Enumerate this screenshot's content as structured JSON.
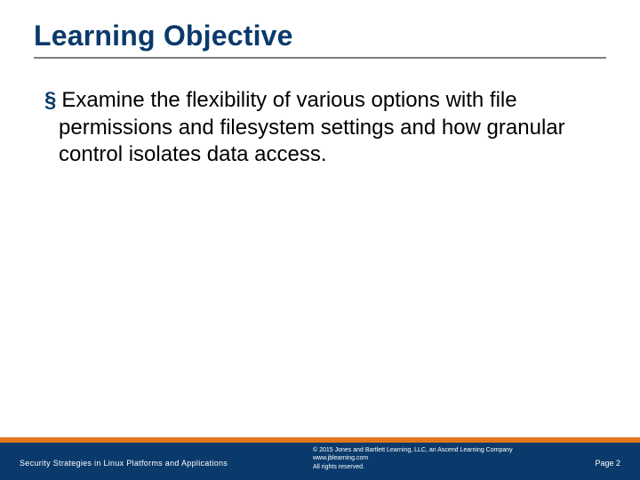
{
  "title": "Learning Objective",
  "bullet": {
    "marker": "§",
    "text": "Examine the flexibility of various options with file permissions and filesystem settings and how granular control isolates data access."
  },
  "footer": {
    "left": "Security Strategies in Linux Platforms and Applications",
    "copyright_line1": "© 2015 Jones and Bartlett Learning, LLC, an Ascend Learning Company",
    "copyright_line2": "www.jblearning.com",
    "copyright_line3": "All rights reserved.",
    "page": "Page 2"
  }
}
